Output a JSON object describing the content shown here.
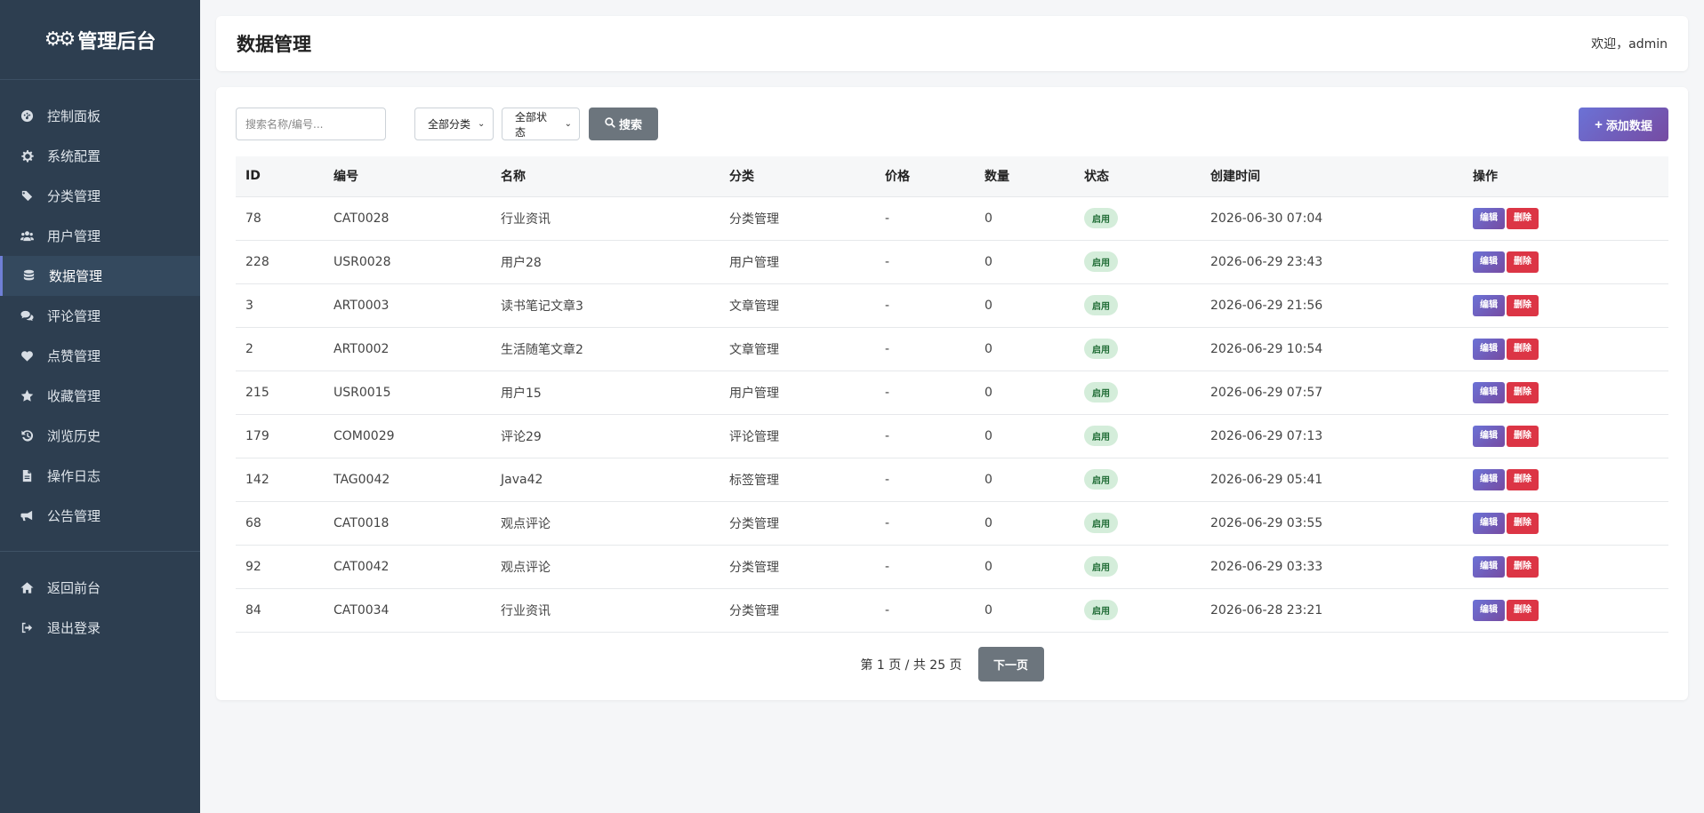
{
  "brand": {
    "title": "管理后台"
  },
  "sidebar": {
    "items": [
      {
        "label": "控制面板",
        "icon": "dashboard-icon"
      },
      {
        "label": "系统配置",
        "icon": "gear-icon"
      },
      {
        "label": "分类管理",
        "icon": "tags-icon"
      },
      {
        "label": "用户管理",
        "icon": "users-icon"
      },
      {
        "label": "数据管理",
        "icon": "database-icon",
        "active": true
      },
      {
        "label": "评论管理",
        "icon": "comments-icon"
      },
      {
        "label": "点赞管理",
        "icon": "heart-icon"
      },
      {
        "label": "收藏管理",
        "icon": "star-icon"
      },
      {
        "label": "浏览历史",
        "icon": "history-icon"
      },
      {
        "label": "操作日志",
        "icon": "file-icon"
      },
      {
        "label": "公告管理",
        "icon": "bullhorn-icon"
      }
    ],
    "bottom_items": [
      {
        "label": "返回前台",
        "icon": "home-icon"
      },
      {
        "label": "退出登录",
        "icon": "sign-out-icon"
      }
    ]
  },
  "header": {
    "title": "数据管理",
    "welcome": "欢迎，admin"
  },
  "toolbar": {
    "search_placeholder": "搜索名称/编号...",
    "category_select": "全部分类",
    "status_select": "全部状态",
    "search_label": "搜索",
    "add_label": "添加数据"
  },
  "table": {
    "columns": [
      "ID",
      "编号",
      "名称",
      "分类",
      "价格",
      "数量",
      "状态",
      "创建时间",
      "操作"
    ],
    "rows": [
      [
        "78",
        "CAT0028",
        "行业资讯",
        "分类管理",
        "-",
        "0",
        "启用",
        "2026-06-30 07:04"
      ],
      [
        "228",
        "USR0028",
        "用户28",
        "用户管理",
        "-",
        "0",
        "启用",
        "2026-06-29 23:43"
      ],
      [
        "3",
        "ART0003",
        "读书笔记文章3",
        "文章管理",
        "-",
        "0",
        "启用",
        "2026-06-29 21:56"
      ],
      [
        "2",
        "ART0002",
        "生活随笔文章2",
        "文章管理",
        "-",
        "0",
        "启用",
        "2026-06-29 10:54"
      ],
      [
        "215",
        "USR0015",
        "用户15",
        "用户管理",
        "-",
        "0",
        "启用",
        "2026-06-29 07:57"
      ],
      [
        "179",
        "COM0029",
        "评论29",
        "评论管理",
        "-",
        "0",
        "启用",
        "2026-06-29 07:13"
      ],
      [
        "142",
        "TAG0042",
        "Java42",
        "标签管理",
        "-",
        "0",
        "启用",
        "2026-06-29 05:41"
      ],
      [
        "68",
        "CAT0018",
        "观点评论",
        "分类管理",
        "-",
        "0",
        "启用",
        "2026-06-29 03:55"
      ],
      [
        "92",
        "CAT0042",
        "观点评论",
        "分类管理",
        "-",
        "0",
        "启用",
        "2026-06-29 03:33"
      ],
      [
        "84",
        "CAT0034",
        "行业资讯",
        "分类管理",
        "-",
        "0",
        "启用",
        "2026-06-28 23:21"
      ]
    ],
    "edit_label": "编辑",
    "delete_label": "删除"
  },
  "pagination": {
    "info": "第 1 页 / 共 25 页",
    "next_label": "下一页"
  },
  "colors": {
    "sidebar_bg": "#2d3e50",
    "accent": "#6b72d6",
    "danger": "#dc3545",
    "secondary": "#6c757d",
    "badge_bg": "#d4edda"
  }
}
